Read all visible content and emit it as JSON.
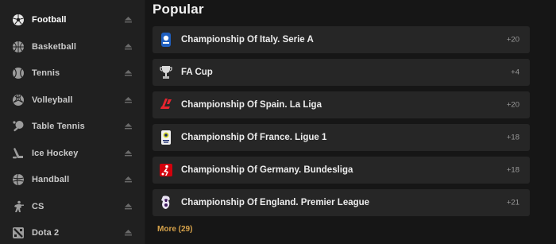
{
  "sidebar": {
    "items": [
      {
        "label": "Football",
        "icon": "football-icon",
        "active": true
      },
      {
        "label": "Basketball",
        "icon": "basketball-icon"
      },
      {
        "label": "Tennis",
        "icon": "tennis-icon"
      },
      {
        "label": "Volleyball",
        "icon": "volleyball-icon"
      },
      {
        "label": "Table Tennis",
        "icon": "table-tennis-icon"
      },
      {
        "label": "Ice Hockey",
        "icon": "ice-hockey-icon"
      },
      {
        "label": "Handball",
        "icon": "handball-icon"
      },
      {
        "label": "CS",
        "icon": "cs-icon"
      },
      {
        "label": "Dota 2",
        "icon": "dota2-icon"
      }
    ]
  },
  "main": {
    "title": "Popular",
    "leagues": [
      {
        "name": "Championship Of Italy. Serie A",
        "count": "+20",
        "logo": "serie-a-logo"
      },
      {
        "name": "FA Cup",
        "count": "+4",
        "logo": "fa-cup-logo"
      },
      {
        "name": "Championship Of Spain. La Liga",
        "count": "+20",
        "logo": "la-liga-logo"
      },
      {
        "name": "Championship Of France. Ligue 1",
        "count": "+18",
        "logo": "ligue-1-logo"
      },
      {
        "name": "Championship Of Germany. Bundesliga",
        "count": "+18",
        "logo": "bundesliga-logo"
      },
      {
        "name": "Championship Of England. Premier League",
        "count": "+21",
        "logo": "premier-league-logo"
      }
    ],
    "more_label": "More (29)"
  },
  "colors": {
    "background": "#161616",
    "sidebar": "#202020",
    "row": "#262626",
    "accent": "#d6a24a"
  }
}
